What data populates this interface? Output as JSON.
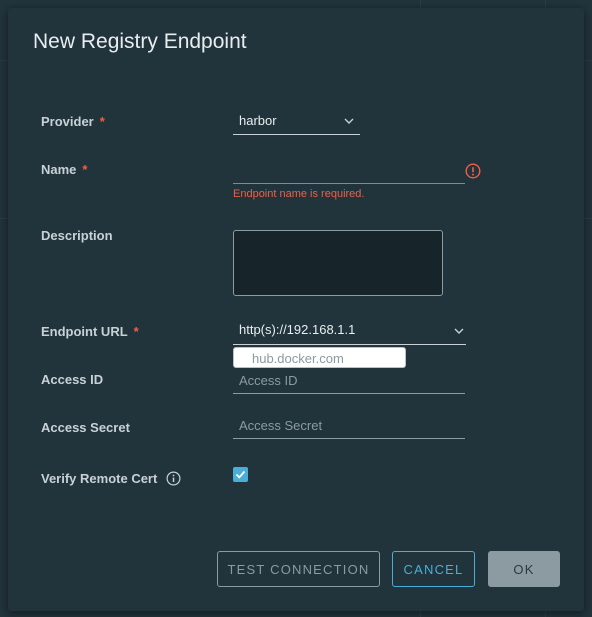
{
  "modal": {
    "title": "New Registry Endpoint"
  },
  "form": {
    "provider": {
      "label": "Provider",
      "required_mark": "*",
      "value": "harbor"
    },
    "name": {
      "label": "Name",
      "required_mark": "*",
      "value": "",
      "error": "Endpoint name is required."
    },
    "description": {
      "label": "Description",
      "value": ""
    },
    "endpoint_url": {
      "label": "Endpoint URL",
      "required_mark": "*",
      "value": "http(s)://192.168.1.1",
      "suggestion": "hub.docker.com"
    },
    "access_id": {
      "label": "Access ID",
      "placeholder": "Access ID"
    },
    "access_secret": {
      "label": "Access Secret",
      "placeholder": "Access Secret"
    },
    "verify_cert": {
      "label": "Verify Remote Cert",
      "checked": true
    }
  },
  "buttons": {
    "test": "TEST CONNECTION",
    "cancel": "CANCEL",
    "ok": "OK"
  },
  "colors": {
    "accent": "#49afd9",
    "error": "#f35e44",
    "modal_bg": "#21333b"
  }
}
